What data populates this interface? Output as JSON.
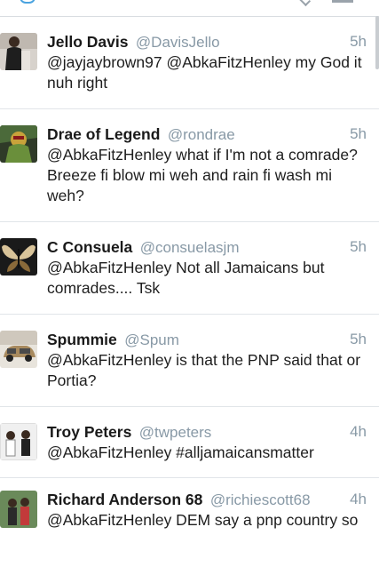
{
  "tweets": [
    {
      "name": "Jello Davis",
      "handle": "@DavisJello",
      "time": "5h",
      "text": "@jayjaybrown97 @AbkaFitzHenley my God it nuh right",
      "avatar": "avatar-jello-davis"
    },
    {
      "name": "Drae of Legend",
      "handle": "@rondrae",
      "time": "5h",
      "text": "@AbkaFitzHenley what if I'm not a comrade? Breeze fi blow mi weh and rain fi wash mi weh?",
      "avatar": "avatar-drae-of-legend"
    },
    {
      "name": "C Consuela",
      "handle": "@consuelasjm",
      "time": "5h",
      "text": "@AbkaFitzHenley Not all Jamaicans but comrades.... Tsk",
      "avatar": "avatar-c-consuela"
    },
    {
      "name": "Spummie",
      "handle": "@Spum",
      "time": "5h",
      "text": "@AbkaFitzHenley is that the PNP said that or Portia?",
      "avatar": "avatar-spummie"
    },
    {
      "name": "Troy Peters",
      "handle": "@twpeters",
      "time": "4h",
      "text": "@AbkaFitzHenley #alljamaicansmatter",
      "avatar": "avatar-troy-peters"
    },
    {
      "name": "Richard Anderson 68",
      "handle": "@richiescott68",
      "time": "4h",
      "text": "@AbkaFitzHenley DEM say a pnp country so",
      "avatar": "avatar-richard-anderson"
    }
  ]
}
